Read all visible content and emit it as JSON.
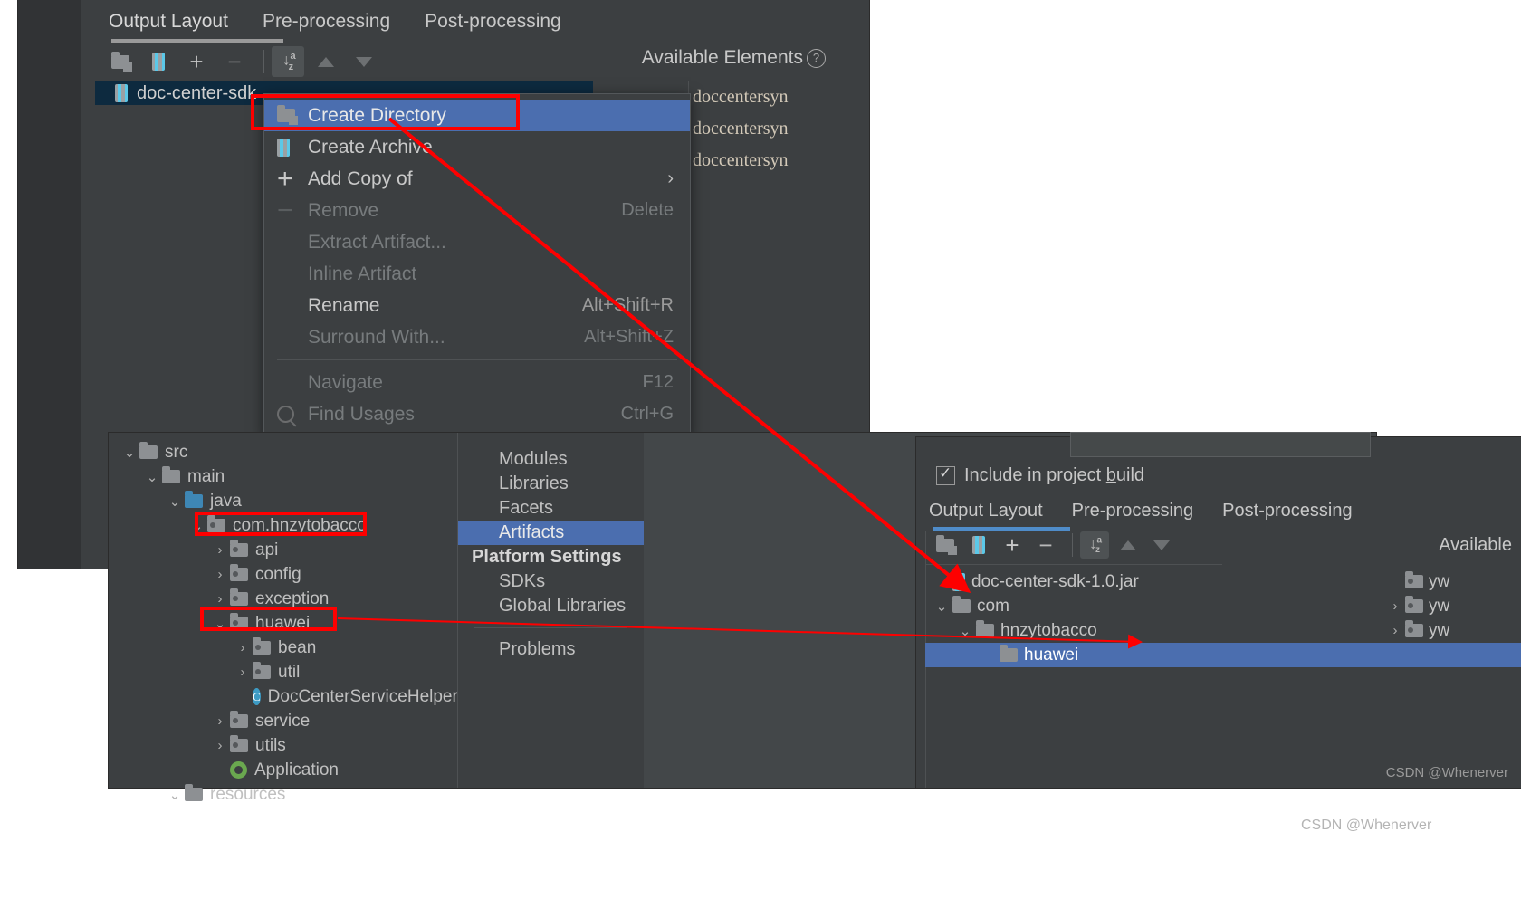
{
  "window1": {
    "tabs": [
      {
        "label": "Output Layout",
        "active": true
      },
      {
        "label": "Pre-processing",
        "active": false
      },
      {
        "label": "Post-processing",
        "active": false
      }
    ],
    "toolbar": [
      {
        "name": "create-directory-icon",
        "label": "Create Directory",
        "enabled": true
      },
      {
        "name": "create-archive-icon",
        "label": "Create Archive",
        "enabled": true
      },
      {
        "name": "add-copy-icon",
        "label": "Add Copy of",
        "enabled": true
      },
      {
        "name": "remove-icon",
        "label": "Remove",
        "enabled": false
      },
      {
        "name": "sort-icon",
        "label": "Sort",
        "enabled": true,
        "active": true
      },
      {
        "name": "move-up-icon",
        "label": "Move Up",
        "enabled": false
      },
      {
        "name": "move-down-icon",
        "label": "Move Down",
        "enabled": false
      }
    ],
    "available_elements_label": "Available Elements",
    "help_icon": "?",
    "jar_row": {
      "icon": "jar-icon",
      "label": "doc-center-sdk"
    },
    "available_items": [
      "doccentersyn",
      "doccentersyn",
      "doccentersyn"
    ]
  },
  "context_menu": {
    "items": [
      {
        "label": "Create Directory",
        "shortcut": "",
        "icon": "create-directory-icon",
        "enabled": true,
        "selected": true
      },
      {
        "label": "Create Archive",
        "shortcut": "",
        "icon": "create-archive-icon",
        "enabled": true,
        "selected": false
      },
      {
        "label": "Add Copy of",
        "shortcut": "",
        "icon": "plus-icon",
        "enabled": true,
        "selected": false,
        "submenu": true
      },
      {
        "label": "Remove",
        "shortcut": "Delete",
        "icon": "minus-icon",
        "enabled": false,
        "selected": false
      },
      {
        "label": "Extract Artifact...",
        "shortcut": "",
        "icon": "",
        "enabled": false,
        "selected": false
      },
      {
        "label": "Inline Artifact",
        "shortcut": "",
        "icon": "",
        "enabled": false,
        "selected": false
      },
      {
        "label": "Rename",
        "shortcut": "Alt+Shift+R",
        "icon": "",
        "enabled": true,
        "selected": false
      },
      {
        "label": "Surround With...",
        "shortcut": "Alt+Shift+Z",
        "icon": "",
        "enabled": false,
        "selected": false
      },
      {
        "separator": true
      },
      {
        "label": "Navigate",
        "shortcut": "F12",
        "icon": "",
        "enabled": false,
        "selected": false
      },
      {
        "label": "Find Usages",
        "shortcut": "Ctrl+G",
        "icon": "search-icon",
        "enabled": false,
        "selected": false
      }
    ]
  },
  "project_tree": {
    "nodes": [
      {
        "label": "src",
        "indent": 0,
        "arrow": "down",
        "icon": "folder-icon",
        "highlight": false
      },
      {
        "label": "main",
        "indent": 1,
        "arrow": "down",
        "icon": "folder-icon",
        "highlight": false
      },
      {
        "label": "java",
        "indent": 2,
        "arrow": "down",
        "icon": "folder-blue-icon",
        "highlight": false
      },
      {
        "label": "com.hnzytobacco",
        "indent": 3,
        "arrow": "down",
        "icon": "package-icon",
        "highlight": true
      },
      {
        "label": "api",
        "indent": 4,
        "arrow": "right",
        "icon": "package-icon",
        "highlight": false
      },
      {
        "label": "config",
        "indent": 4,
        "arrow": "right",
        "icon": "package-icon",
        "highlight": false
      },
      {
        "label": "exception",
        "indent": 4,
        "arrow": "right",
        "icon": "package-icon",
        "highlight": false
      },
      {
        "label": "huawei",
        "indent": 4,
        "arrow": "down",
        "icon": "package-icon",
        "highlight": true
      },
      {
        "label": "bean",
        "indent": 5,
        "arrow": "right",
        "icon": "package-icon",
        "highlight": false
      },
      {
        "label": "util",
        "indent": 5,
        "arrow": "right",
        "icon": "package-icon",
        "highlight": false
      },
      {
        "label": "DocCenterServiceHelper",
        "indent": 5,
        "arrow": "none",
        "icon": "class-icon",
        "highlight": false
      },
      {
        "label": "service",
        "indent": 4,
        "arrow": "right",
        "icon": "package-icon",
        "highlight": false
      },
      {
        "label": "utils",
        "indent": 4,
        "arrow": "right",
        "icon": "package-icon",
        "highlight": false
      },
      {
        "label": "Application",
        "indent": 4,
        "arrow": "none",
        "icon": "spring-class-icon",
        "highlight": false
      },
      {
        "label": "resources",
        "indent": 2,
        "arrow": "down",
        "icon": "folder-icon",
        "highlight": false
      }
    ]
  },
  "settings_nav": {
    "items": [
      {
        "label": "Modules",
        "selected": false,
        "header": false
      },
      {
        "label": "Libraries",
        "selected": false,
        "header": false
      },
      {
        "label": "Facets",
        "selected": false,
        "header": false
      },
      {
        "label": "Artifacts",
        "selected": true,
        "header": false
      },
      {
        "label": "Platform Settings",
        "selected": false,
        "header": true
      },
      {
        "label": "SDKs",
        "selected": false,
        "header": false
      },
      {
        "label": "Global Libraries",
        "selected": false,
        "header": false
      },
      {
        "separator": true
      },
      {
        "label": "Problems",
        "selected": false,
        "header": false
      }
    ]
  },
  "window3": {
    "checkbox": {
      "label_pre": "Include in project ",
      "label_key": "b",
      "label_post": "uild",
      "checked": true
    },
    "tabs": [
      {
        "label": "Output Layout",
        "active": true
      },
      {
        "label": "Pre-processing",
        "active": false
      },
      {
        "label": "Post-processing",
        "active": false
      }
    ],
    "toolbar": [
      {
        "name": "create-directory-icon",
        "label": "Create Directory",
        "enabled": true
      },
      {
        "name": "create-archive-icon",
        "label": "Create Archive",
        "enabled": true
      },
      {
        "name": "add-copy-icon",
        "label": "Add Copy of",
        "enabled": true
      },
      {
        "name": "remove-icon",
        "label": "Remove",
        "enabled": true
      },
      {
        "name": "sort-icon",
        "label": "Sort",
        "enabled": true,
        "active": true
      },
      {
        "name": "move-up-icon",
        "label": "Move Up",
        "enabled": false
      },
      {
        "name": "move-down-icon",
        "label": "Move Down",
        "enabled": false
      }
    ],
    "available_label": "Available",
    "tree": [
      {
        "label": "doc-center-sdk-1.0.jar",
        "indent": 0,
        "arrow": "none",
        "icon": "jar-icon",
        "selected": false
      },
      {
        "label": "com",
        "indent": 0,
        "arrow": "down",
        "icon": "folder-icon",
        "selected": false
      },
      {
        "label": "hnzytobacco",
        "indent": 1,
        "arrow": "down",
        "icon": "folder-icon",
        "selected": false
      },
      {
        "label": "huawei",
        "indent": 2,
        "arrow": "none",
        "icon": "folder-icon",
        "selected": true
      }
    ],
    "available_items": [
      {
        "label": "yw",
        "arrow": "none"
      },
      {
        "label": "yw",
        "arrow": "right"
      },
      {
        "label": "yw",
        "arrow": "right"
      }
    ],
    "watermark": "CSDN @Whenerver"
  },
  "watermark_outer": "CSDN @Whenerver"
}
